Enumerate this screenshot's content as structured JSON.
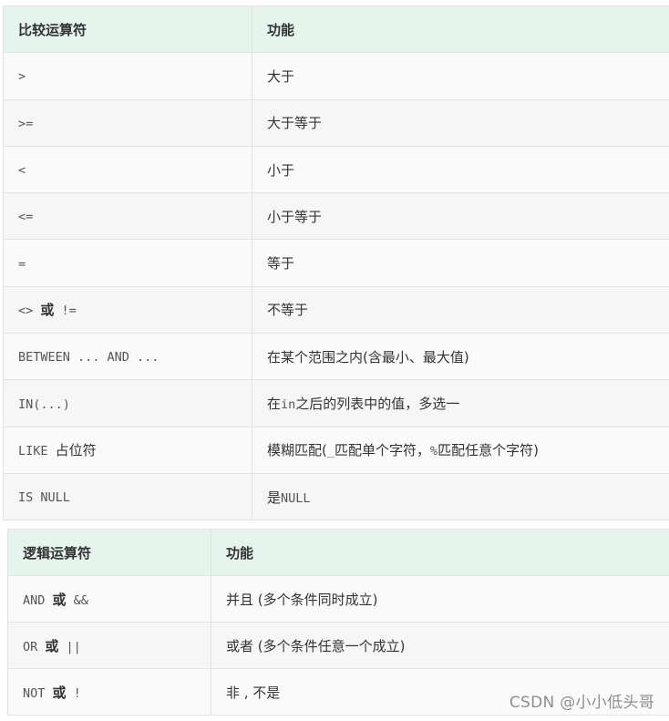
{
  "comparison": {
    "headers": [
      "比较运算符",
      "功能"
    ],
    "rows": [
      {
        "op": [
          ">"
        ],
        "func": [
          "大于"
        ]
      },
      {
        "op": [
          ">="
        ],
        "func": [
          "大于等于"
        ]
      },
      {
        "op": [
          "<"
        ],
        "func": [
          "小于"
        ]
      },
      {
        "op": [
          "<="
        ],
        "func": [
          "小于等于"
        ]
      },
      {
        "op": [
          "="
        ],
        "func": [
          "等于"
        ]
      },
      {
        "op": [
          "<> ",
          "或",
          " !="
        ],
        "func": [
          "不等于"
        ]
      },
      {
        "op": [
          "BETWEEN ... AND ..."
        ],
        "func": [
          "在某个范围之内(含最小、最大值)"
        ]
      },
      {
        "op": [
          "IN(...)"
        ],
        "func": [
          "在",
          "in",
          "之后的列表中的值，多选一"
        ]
      },
      {
        "op": [
          "LIKE ",
          "占位符"
        ],
        "func": [
          "模糊匹配(",
          "_",
          "匹配单个字符，",
          "%",
          "匹配任意个字符)"
        ]
      },
      {
        "op": [
          "IS NULL"
        ],
        "func": [
          "是",
          "NULL"
        ]
      }
    ]
  },
  "logical": {
    "headers": [
      "逻辑运算符",
      "功能"
    ],
    "rows": [
      {
        "op": [
          "AND ",
          "或",
          " &&"
        ],
        "func": [
          "并且 (多个条件同时成立)"
        ]
      },
      {
        "op": [
          "OR ",
          "或",
          " ||"
        ],
        "func": [
          "或者 (多个条件任意一个成立)"
        ]
      },
      {
        "op": [
          "NOT ",
          "或",
          " !"
        ],
        "func": [
          "非 , 不是"
        ]
      }
    ]
  },
  "watermark": "CSDN @小小低头哥"
}
